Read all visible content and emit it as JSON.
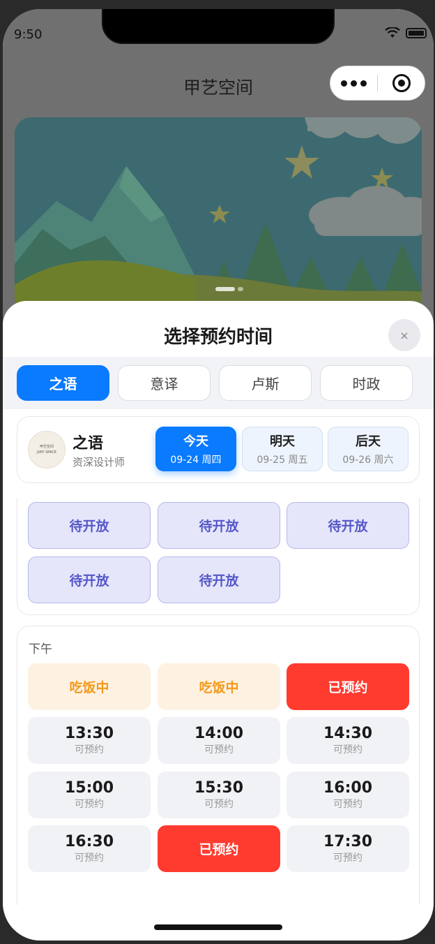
{
  "status_bar": {
    "time": "9:50"
  },
  "nav": {
    "title": "甲艺空间"
  },
  "sheet": {
    "title": "选择预约时间",
    "close_label": "×"
  },
  "tabs": [
    {
      "label": "之语",
      "active": true
    },
    {
      "label": "意译",
      "active": false
    },
    {
      "label": "卢斯",
      "active": false
    },
    {
      "label": "时政",
      "active": false
    }
  ],
  "designer": {
    "name": "之语",
    "role": "资深设计师",
    "avatar_text_1": "甲艺空间",
    "avatar_text_2": "JIAYI SPACE"
  },
  "days": [
    {
      "name": "今天",
      "date": "09-24 周四",
      "active": true
    },
    {
      "name": "明天",
      "date": "09-25 周五",
      "active": false
    },
    {
      "name": "后天",
      "date": "09-26 周六",
      "active": false
    }
  ],
  "morning": {
    "slots": [
      {
        "label": "待开放",
        "state": "pending"
      },
      {
        "label": "待开放",
        "state": "pending"
      },
      {
        "label": "待开放",
        "state": "pending"
      },
      {
        "label": "待开放",
        "state": "pending"
      },
      {
        "label": "待开放",
        "state": "pending"
      }
    ]
  },
  "afternoon": {
    "label": "下午",
    "slots": [
      {
        "label": "吃饭中",
        "state": "lunch"
      },
      {
        "label": "吃饭中",
        "state": "lunch"
      },
      {
        "label": "已预约",
        "state": "booked"
      },
      {
        "time": "13:30",
        "sub": "可预约",
        "state": "open"
      },
      {
        "time": "14:00",
        "sub": "可预约",
        "state": "open"
      },
      {
        "time": "14:30",
        "sub": "可预约",
        "state": "open"
      },
      {
        "time": "15:00",
        "sub": "可预约",
        "state": "open"
      },
      {
        "time": "15:30",
        "sub": "可预约",
        "state": "open"
      },
      {
        "time": "16:00",
        "sub": "可预约",
        "state": "open"
      },
      {
        "time": "16:30",
        "sub": "可预约",
        "state": "open"
      },
      {
        "label": "已预约",
        "state": "booked"
      },
      {
        "time": "17:30",
        "sub": "可预约",
        "state": "open"
      }
    ]
  },
  "colors": {
    "accent": "#0a7aff",
    "booked": "#ff3b30",
    "lunch_text": "#f59a1a",
    "pending_text": "#5557c8"
  }
}
